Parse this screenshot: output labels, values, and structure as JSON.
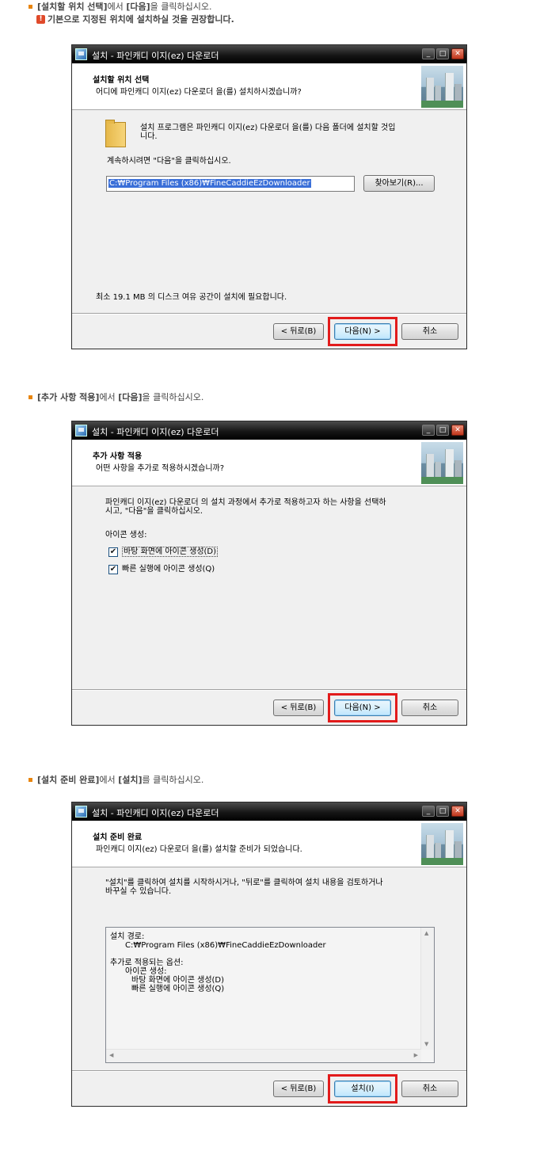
{
  "steps": [
    {
      "bold": "[설치할 위치 선택]",
      "mid": "에서 ",
      "bold2": "[다음]",
      "end": "을 클릭하십시오."
    },
    {
      "bold": "[추가 사항 적용]",
      "mid": "에서 ",
      "bold2": "[다음]",
      "end": "을 클릭하십시오."
    },
    {
      "bold": "[설치 준비 완료]",
      "mid": "에서 ",
      "bold2": "[설치]",
      "end": "를 클릭하십시오."
    }
  ],
  "note": {
    "icon": "!",
    "text": "기본으로 지정된 위치에 설치하실 것을 권장합니다."
  },
  "window_title": "설치 - 파인캐디 이지(ez) 다운로더",
  "window_buttons": {
    "min": "_",
    "max": "□",
    "close": "✕"
  },
  "dialog1": {
    "header_title": "설치할 위치 선택",
    "header_sub": "어디에 파인캐디 이지(ez) 다운로더 을(를) 설치하시겠습니까?",
    "line1": "설치 프로그램은 파인캐디 이지(ez) 다운로더 을(를) 다음 폴더에 설치할 것입",
    "line2": "니다.",
    "continue": "계속하시려면 \"다음\"을 클릭하십시오.",
    "path": "C:₩Program Files (x86)₩FineCaddieEzDownloader",
    "browse": "찾아보기(R)...",
    "space": "최소 19.1 MB 의 디스크 여유 공간이 설치에 필요합니다.",
    "back": "< 뒤로(B)",
    "next": "다음(N) >",
    "cancel": "취소"
  },
  "dialog2": {
    "header_title": "추가 사항 적용",
    "header_sub": "어떤 사항을 추가로 적용하시겠습니까?",
    "line1": "파인캐디 이지(ez) 다운로더 의 설치 과정에서 추가로 적용하고자 하는 사항을 선택하",
    "line2": "시고, \"다음\"을 클릭하십시오.",
    "group": "아이콘 생성:",
    "check1": "바탕 화면에 아이콘 생성(D)",
    "check2": "빠른 실행에 아이콘 생성(Q)",
    "check_mark": "✔",
    "back": "< 뒤로(B)",
    "next": "다음(N) >",
    "cancel": "취소"
  },
  "dialog3": {
    "header_title": "설치 준비 완료",
    "header_sub": "파인캐디 이지(ez) 다운로더 을(를) 설치할 준비가 되었습니다.",
    "line1": "\"설치\"를 클릭하여 설치를 시작하시거나, \"뒤로\"를 클릭하여 설치 내용을 검토하거나",
    "line2": "바꾸실 수 있습니다.",
    "memo": [
      "설치 경로:",
      "C:₩Program Files (x86)₩FineCaddieEzDownloader",
      "추가로 적용되는 옵션:",
      "아이콘 생성:",
      "바탕 화면에 아이콘 생성(D)",
      "빠른 실행에 아이콘 생성(Q)"
    ],
    "back": "< 뒤로(B)",
    "install": "설치(I)",
    "cancel": "취소"
  },
  "colors": {
    "highlight": "#e21b1b",
    "bullet": "#e8850e",
    "selection": "#3a6fd8"
  }
}
